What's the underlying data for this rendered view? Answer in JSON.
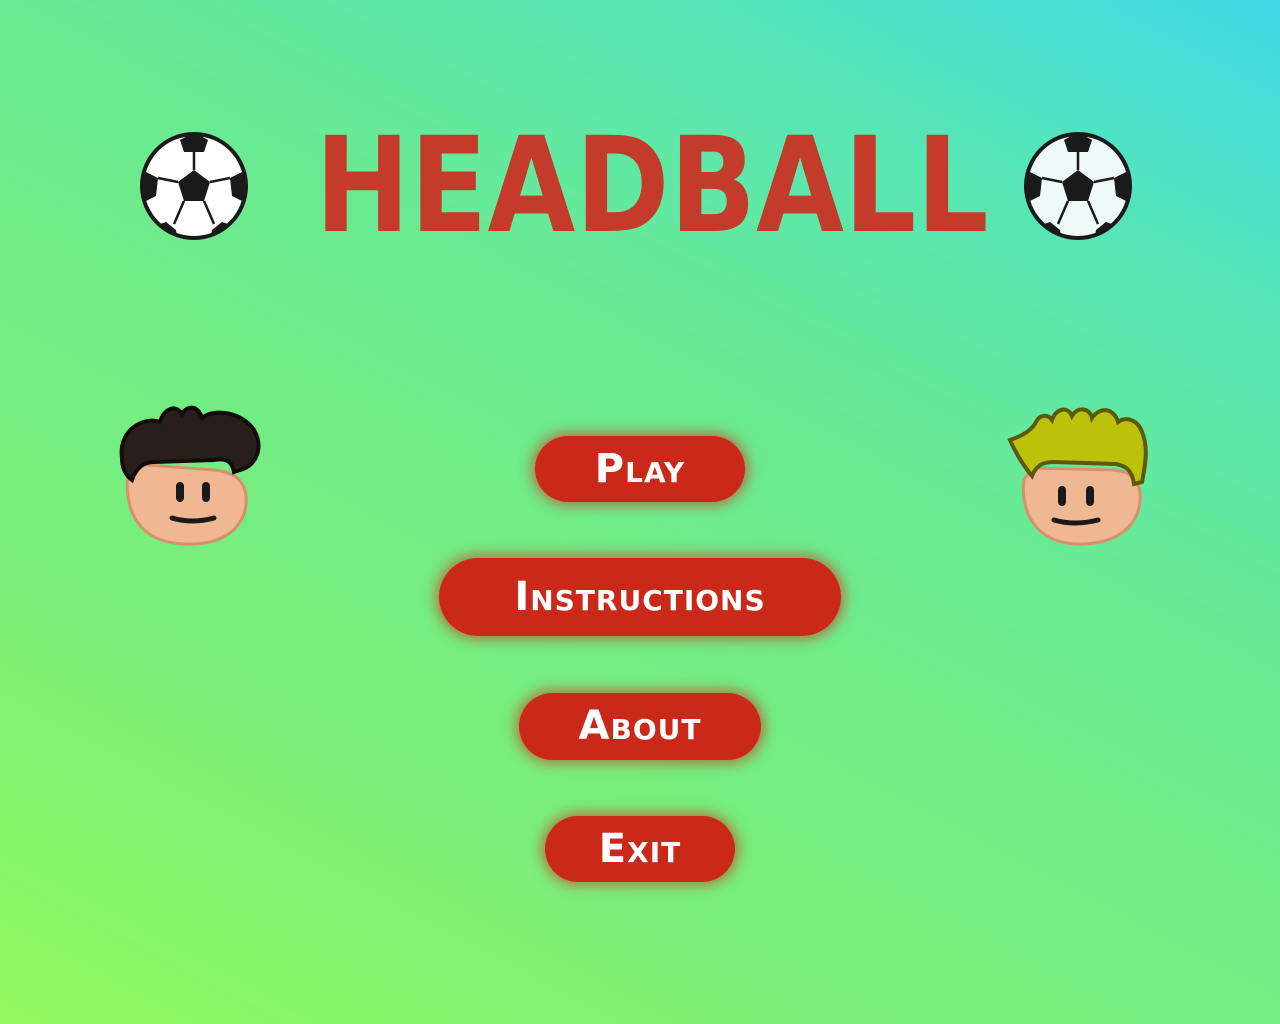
{
  "title": "HEADBALL",
  "menu": {
    "play": "Play",
    "instructions": "Instructions",
    "about": "About",
    "exit": "Exit"
  },
  "colors": {
    "title": "#c43b2b",
    "button": "#ca2818",
    "button_text": "#ffffff",
    "bg_top_right": "#41d9e8",
    "bg_bottom_left": "#92fa5e"
  },
  "icons": {
    "ball_left": "soccer-ball-icon",
    "ball_right": "soccer-ball-icon",
    "player_left": "player-dark-hair-avatar",
    "player_right": "player-blonde-hair-avatar"
  }
}
